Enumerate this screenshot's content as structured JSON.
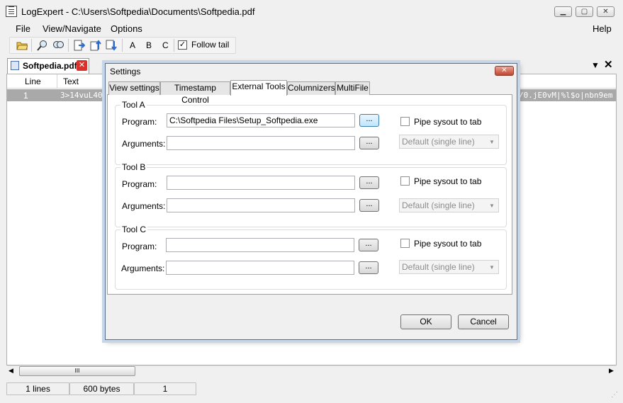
{
  "window": {
    "title": "LogExpert - C:\\Users\\Softpedia\\Documents\\Softpedia.pdf",
    "minimize": "▁",
    "maximize": "▢",
    "close": "✕"
  },
  "menu": {
    "file": "File",
    "view": "View/Navigate",
    "options": "Options",
    "help": "Help"
  },
  "toolbar": {
    "tool_a": "A",
    "tool_b": "B",
    "tool_c": "C",
    "follow_tail": "Follow tail",
    "follow_tail_checked": "✓"
  },
  "tabs": {
    "file_tab": "Softpedia.pdf",
    "close": "✕",
    "dropdown": "▼",
    "close_all": "✕"
  },
  "grid": {
    "columns": [
      "Line",
      "Text"
    ],
    "row": {
      "line": "1",
      "text": "3>14vuL40",
      "text_right": "/0.jE0vM|%l$o|nbn9em"
    },
    "scroll_left": "◀",
    "scroll_right": "▶",
    "thumb_grip": "III"
  },
  "status": {
    "lines": "1 lines",
    "bytes": "600 bytes",
    "position": "1"
  },
  "dialog": {
    "title": "Settings",
    "close": "✕",
    "tabs": [
      "View settings",
      "Timestamp Control",
      "External Tools",
      "Columnizers",
      "MultiFile"
    ],
    "tools": [
      {
        "title": "Tool A",
        "program_label": "Program:",
        "program": "C:\\Softpedia Files\\Setup_Softpedia.exe",
        "arguments_label": "Arguments:",
        "arguments": "",
        "browse": "...",
        "pipe_label": "Pipe sysout to tab",
        "combo": "Default (single line)"
      },
      {
        "title": "Tool B",
        "program_label": "Program:",
        "program": "",
        "arguments_label": "Arguments:",
        "arguments": "",
        "browse": "...",
        "pipe_label": "Pipe sysout to tab",
        "combo": "Default (single line)"
      },
      {
        "title": "Tool C",
        "program_label": "Program:",
        "program": "",
        "arguments_label": "Arguments:",
        "arguments": "",
        "browse": "...",
        "pipe_label": "Pipe sysout to tab",
        "combo": "Default (single line)"
      }
    ],
    "ok": "OK",
    "cancel": "Cancel"
  }
}
